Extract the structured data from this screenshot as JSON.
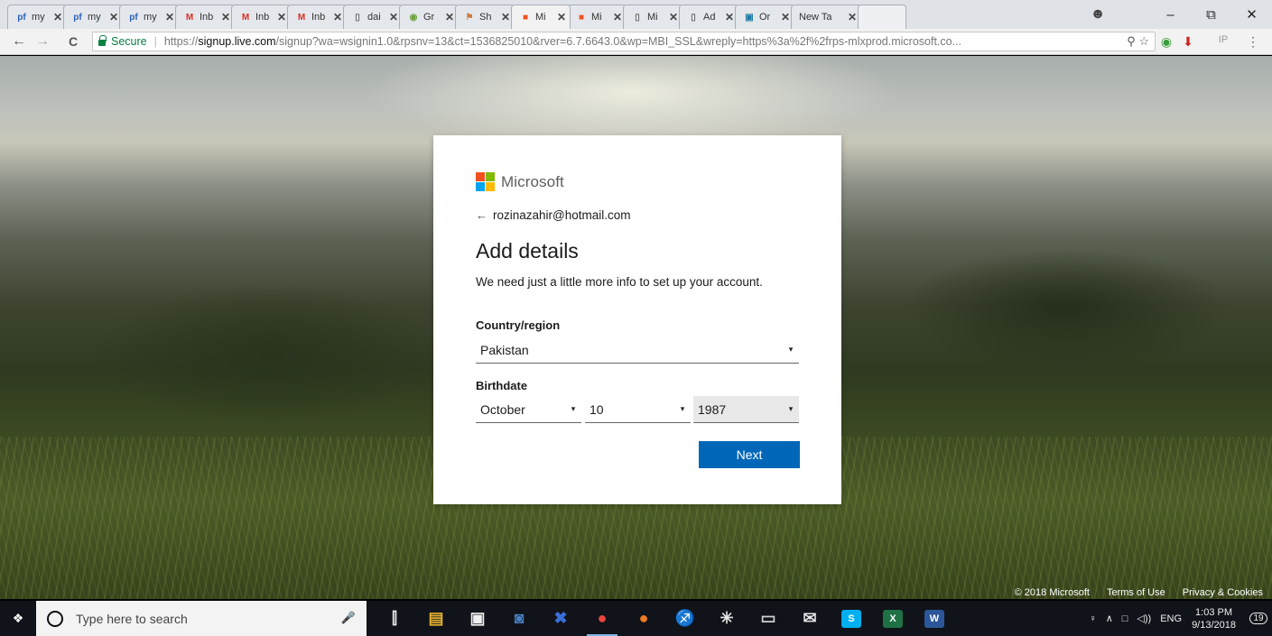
{
  "browser": {
    "tabs": [
      {
        "icon": "pf-icon",
        "icon_text": "pf",
        "icon_color": "#2b5fb7",
        "title": "my",
        "active": false
      },
      {
        "icon": "pf-icon",
        "icon_text": "pf",
        "icon_color": "#2b5fb7",
        "title": "my",
        "active": false
      },
      {
        "icon": "pf-icon",
        "icon_text": "pf",
        "icon_color": "#2b5fb7",
        "title": "my",
        "active": false
      },
      {
        "icon": "gmail-icon",
        "icon_text": "M",
        "icon_color": "#d93025",
        "title": "Inb",
        "active": false
      },
      {
        "icon": "gmail-icon",
        "icon_text": "M",
        "icon_color": "#d93025",
        "title": "Inb",
        "active": false
      },
      {
        "icon": "gmail-icon",
        "icon_text": "M",
        "icon_color": "#d93025",
        "title": "Inb",
        "active": false
      },
      {
        "icon": "document-icon",
        "icon_text": "▯",
        "icon_color": "#666666",
        "title": "dai",
        "active": false
      },
      {
        "icon": "grammarly-icon",
        "icon_text": "◉",
        "icon_color": "#6aa23b",
        "title": "Gr",
        "active": false
      },
      {
        "icon": "shield-icon",
        "icon_text": "⚑",
        "icon_color": "#d07a3a",
        "title": "Sh",
        "active": false
      },
      {
        "icon": "microsoft-icon",
        "icon_text": "■",
        "icon_color": "#f25022",
        "title": "Mi",
        "active": true
      },
      {
        "icon": "microsoft-icon",
        "icon_text": "■",
        "icon_color": "#f25022",
        "title": "Mi",
        "active": false
      },
      {
        "icon": "document-icon",
        "icon_text": "▯",
        "icon_color": "#666666",
        "title": "Mi",
        "active": false
      },
      {
        "icon": "document-icon",
        "icon_text": "▯",
        "icon_color": "#666666",
        "title": "Ad",
        "active": false
      },
      {
        "icon": "app-icon",
        "icon_text": "▣",
        "icon_color": "#1f7ea8",
        "title": "Or",
        "active": false
      },
      {
        "icon": "",
        "icon_text": "",
        "icon_color": "#666666",
        "title": "New Ta",
        "active": false
      }
    ],
    "tab_close_glyph": "✕",
    "window_controls": {
      "minimize": "–",
      "maximize": "⧉",
      "close": "✕"
    },
    "nav": {
      "back": "←",
      "forward": "→",
      "reload": "C"
    },
    "address": {
      "secure_label": "Secure",
      "separator": "|",
      "scheme": "https://",
      "host": "signup.live.com",
      "rest": "/signup?wa=wsignin1.0&rpsnv=13&ct=1536825010&rver=6.7.6643.0&wp=MBI_SSL&wreply=https%3a%2f%2frps-mlxprod.microsoft.co..."
    }
  },
  "card": {
    "brand": "Microsoft",
    "brand_colors": [
      "#f25022",
      "#7fba00",
      "#00a4ef",
      "#ffb900"
    ],
    "identity_back_glyph": "←",
    "identity_email": "rozinazahir@hotmail.com",
    "title": "Add details",
    "description": "We need just a little more info to set up your account.",
    "country_label": "Country/region",
    "country_value": "Pakistan",
    "birthdate_label": "Birthdate",
    "birth_month": "October",
    "birth_day": "10",
    "birth_year": "1987",
    "caret": "▾",
    "next_label": "Next",
    "accent_color": "#0067b8"
  },
  "footer": {
    "copyright": "© 2018 Microsoft",
    "terms": "Terms of Use",
    "privacy": "Privacy & Cookies"
  },
  "taskbar": {
    "search_placeholder": "Type here to search",
    "apps": [
      {
        "name": "task-view-icon",
        "glyph": "⫿",
        "color": ""
      },
      {
        "name": "file-explorer-icon",
        "glyph": "▤",
        "color": "#e8b431"
      },
      {
        "name": "store-icon",
        "glyph": "▣",
        "color": "#f0f0f0"
      },
      {
        "name": "network-icon",
        "glyph": "◙",
        "color": "#4a7fc1"
      },
      {
        "name": "app-x-icon",
        "glyph": "✖",
        "color": "#3a6fd8"
      },
      {
        "name": "chrome-icon",
        "glyph": "●",
        "color": "#e8453c",
        "active": true
      },
      {
        "name": "firefox-icon",
        "glyph": "●",
        "color": "#f07a1e"
      },
      {
        "name": "stocks-icon",
        "glyph": "♐",
        "color": "#6cbf3c"
      },
      {
        "name": "snipping-icon",
        "glyph": "✳",
        "color": ""
      },
      {
        "name": "terminal-icon",
        "glyph": "▭",
        "color": "#cfcfcf"
      },
      {
        "name": "mail-icon",
        "glyph": "✉",
        "color": ""
      },
      {
        "name": "skype-icon",
        "glyph": "S",
        "color": "#00aff0"
      },
      {
        "name": "excel-icon",
        "glyph": "X",
        "color": "#1e7145"
      },
      {
        "name": "word-icon",
        "glyph": "W",
        "color": "#2b579a"
      }
    ],
    "tray": {
      "people_glyph": "♀",
      "chevron": "∧",
      "network_glyph": "□",
      "volume_glyph": "◁))",
      "language": "ENG",
      "time": "1:03 PM",
      "date": "9/13/2018",
      "notification_count": "19"
    }
  }
}
